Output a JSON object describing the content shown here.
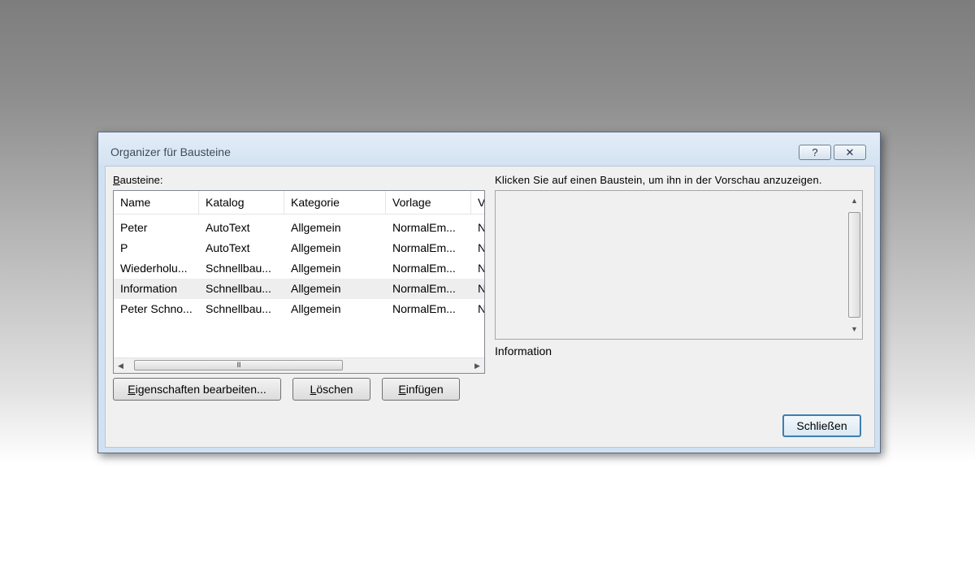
{
  "dialog": {
    "title": "Organizer für Bausteine",
    "help_label": "?",
    "close_label": "✕"
  },
  "list": {
    "label_ul": "B",
    "label_rest": "austeine:",
    "columns": [
      "Name",
      "Katalog",
      "Kategorie",
      "Vorlage",
      "V"
    ],
    "rows": [
      [
        "Peter",
        "AutoText",
        "Allgemein",
        "NormalEm...",
        "N"
      ],
      [
        "P",
        "AutoText",
        "Allgemein",
        "NormalEm...",
        "N"
      ],
      [
        "Wiederholu...",
        "Schnellbau...",
        "Allgemein",
        "NormalEm...",
        "N"
      ],
      [
        "Information",
        "Schnellbau...",
        "Allgemein",
        "NormalEm...",
        "N"
      ],
      [
        "Peter Schno...",
        "Schnellbau...",
        "Allgemein",
        "NormalEm...",
        "N"
      ]
    ],
    "selected_row": 3,
    "scroll_left": "◀",
    "scroll_right": "▶",
    "scroll_grip": "III"
  },
  "buttons": {
    "edit_ul": "E",
    "edit_rest": "igenschaften bearbeiten...",
    "delete_ul": "L",
    "delete_rest": "öschen",
    "insert_ul": "E",
    "insert_rest": "infügen",
    "close": "Schließen"
  },
  "preview": {
    "prompt": "Klicken Sie auf einen Baustein, um ihn in der Vorschau anzuzeigen.",
    "info_label": "Information",
    "scroll_up": "▲",
    "scroll_down": "▼"
  }
}
